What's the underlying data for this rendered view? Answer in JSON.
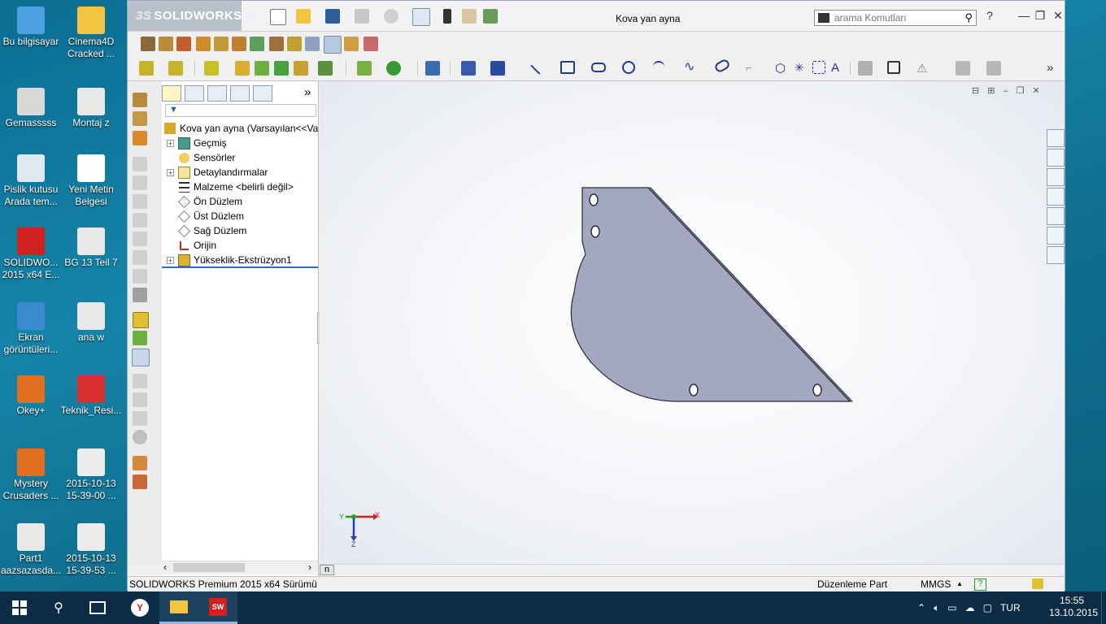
{
  "desktop": {
    "icons": [
      {
        "label": "Bu bilgisayar",
        "icon": "computer-icon"
      },
      {
        "label": "Cinema4D Cracked ...",
        "icon": "folder-icon"
      },
      {
        "label": "Gemasssss",
        "icon": "drive-icon"
      },
      {
        "label": "Montaj z",
        "icon": "part-file-icon"
      },
      {
        "label": "Pislik kutusu Arada tem...",
        "icon": "recycle-bin-icon"
      },
      {
        "label": "Yeni Metin Belgesi",
        "icon": "text-document-icon"
      },
      {
        "label": "SOLIDWO... 2015 x64 E...",
        "icon": "solidworks-icon"
      },
      {
        "label": "BG 13 Teil 7",
        "icon": "part-file-icon"
      },
      {
        "label": "Ekran görüntüleri...",
        "icon": "screenshot-folder-icon"
      },
      {
        "label": "ana w",
        "icon": "part-file-icon"
      },
      {
        "label": "Okey+",
        "icon": "game-icon"
      },
      {
        "label": "Teknik_Resi...",
        "icon": "pdf-icon"
      },
      {
        "label": "Mystery Crusaders ...",
        "icon": "game-icon"
      },
      {
        "label": "2015-10-13 15-39-00 ...",
        "icon": "image-file-icon"
      },
      {
        "label": "Part1 aazsazasda...",
        "icon": "part-file-icon"
      },
      {
        "label": "2015-10-13 15-39-53 ...",
        "icon": "image-file-icon"
      }
    ]
  },
  "app": {
    "brand_prefix": "3S",
    "brand": "SOLIDWORKS",
    "window_title": "Kova yan ayna",
    "search_placeholder": "arama Komutları",
    "help": "?",
    "minimize": "—",
    "maximize": "❐",
    "close": "✕"
  },
  "tree": {
    "root": "Kova yan ayna  (Varsayılan<<Va",
    "items": [
      {
        "label": "Geçmiş",
        "expandable": true,
        "icon": "history-icon"
      },
      {
        "label": "Sensörler",
        "expandable": false,
        "icon": "sensor-icon"
      },
      {
        "label": "Detaylandırmalar",
        "expandable": true,
        "icon": "annotation-icon"
      },
      {
        "label": "Malzeme <belirli değil>",
        "expandable": false,
        "icon": "material-icon"
      },
      {
        "label": "Ön Düzlem",
        "expandable": false,
        "icon": "plane-icon"
      },
      {
        "label": "Üst Düzlem",
        "expandable": false,
        "icon": "plane-icon"
      },
      {
        "label": "Sağ Düzlem",
        "expandable": false,
        "icon": "plane-icon"
      },
      {
        "label": "Orijin",
        "expandable": false,
        "icon": "origin-icon"
      },
      {
        "label": "Yükseklik-Ekstrüzyon1",
        "expandable": true,
        "icon": "extrude-icon"
      }
    ],
    "more_chevron": "»"
  },
  "viewport": {
    "triad_x": "X",
    "triad_z": "Z",
    "triad_y": "Y",
    "hscroll_label": "n"
  },
  "status": {
    "product": "SOLIDWORKS Premium 2015 x64 Sürümü",
    "mode": "Düzenleme Part",
    "units": "MMGS",
    "units_arrow": "▲"
  },
  "taskbar": {
    "language": "TUR",
    "time": "15:55",
    "date": "13.10.2015"
  },
  "colors": {
    "part_face": "#a3a7c0",
    "part_edge": "#2a2a36",
    "taskbar": "#0c2c45"
  }
}
